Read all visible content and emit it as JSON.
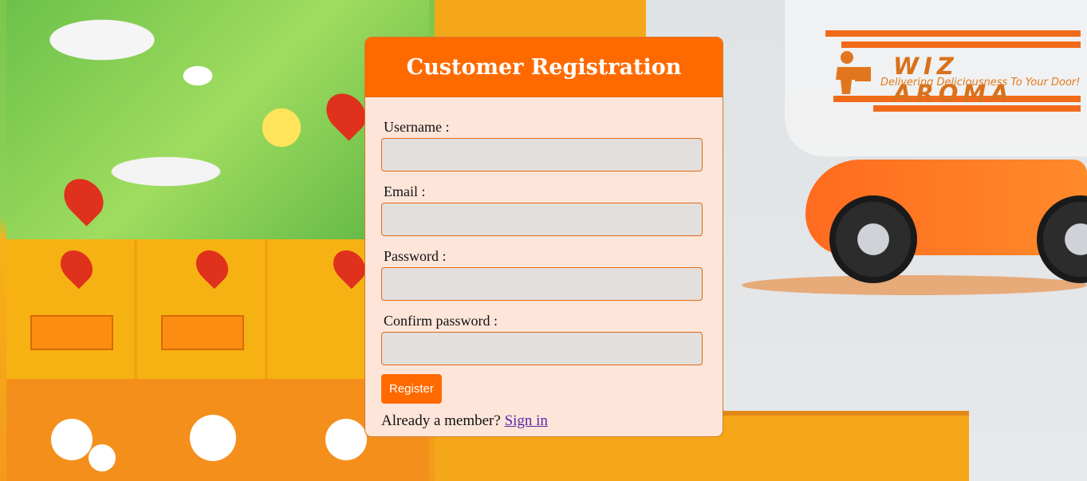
{
  "form": {
    "title": "Customer Registration",
    "username_label": "Username :",
    "email_label": "Email :",
    "password_label": "Password :",
    "confirm_label": "Confirm password :",
    "username_value": "",
    "email_value": "",
    "password_value": "",
    "confirm_value": "",
    "register_label": "Register",
    "member_prompt": "Already a member?",
    "signin_label": "Sign in"
  },
  "logo": {
    "name": "WIZ AROMA",
    "tagline": "Delivering Deliciousness To Your Door!",
    "icon": "delivery-person-icon"
  },
  "theme": {
    "accent": "#ff6a00",
    "card_bg": "#fde5d9",
    "input_bg": "#e3dfdd",
    "link": "#5a2aa6"
  }
}
